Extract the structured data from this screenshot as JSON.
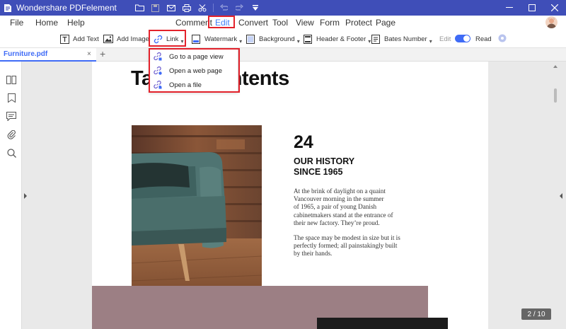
{
  "app": {
    "title": "Wondershare PDFelement"
  },
  "menu": {
    "items": [
      "File",
      "Home",
      "Help",
      "Comment",
      "Edit",
      "Convert",
      "Tool",
      "View",
      "Form",
      "Protect",
      "Page"
    ],
    "active": "Edit"
  },
  "toolbar": {
    "add_text": "Add Text",
    "add_image": "Add Image",
    "link": "Link",
    "watermark": "Watermark",
    "background": "Background",
    "header_footer": "Header & Footer",
    "bates_number": "Bates Number",
    "mode_edit": "Edit",
    "mode_read": "Read"
  },
  "tabs": {
    "document": "Furniture.pdf",
    "close": "×",
    "add": "+"
  },
  "link_menu": {
    "items": [
      "Go to a page view",
      "Open a web page",
      "Open a file"
    ]
  },
  "document": {
    "title": "Table of Contents",
    "title_visible_left": "Ta",
    "title_visible_right": "ntents",
    "number": "24",
    "heading_line1": "OUR HISTORY",
    "heading_line2": "SINCE 1965",
    "paragraph1_lines": [
      "At the brink of daylight on a quaint",
      "Vancouver morning in the summer",
      "of 1965, a pair of young Danish",
      "cabinetmakers stand at the entrance of",
      "their new factory. They’re proud."
    ],
    "paragraph2_lines": [
      "The space may be modest in size but it is",
      "perfectly formed; all painstakingly built",
      "by their hands."
    ]
  },
  "page_indicator": "2 / 10",
  "colors": {
    "titlebar": "#3f4eb8",
    "accent": "#3f6bf6",
    "highlight": "#e3222b"
  }
}
